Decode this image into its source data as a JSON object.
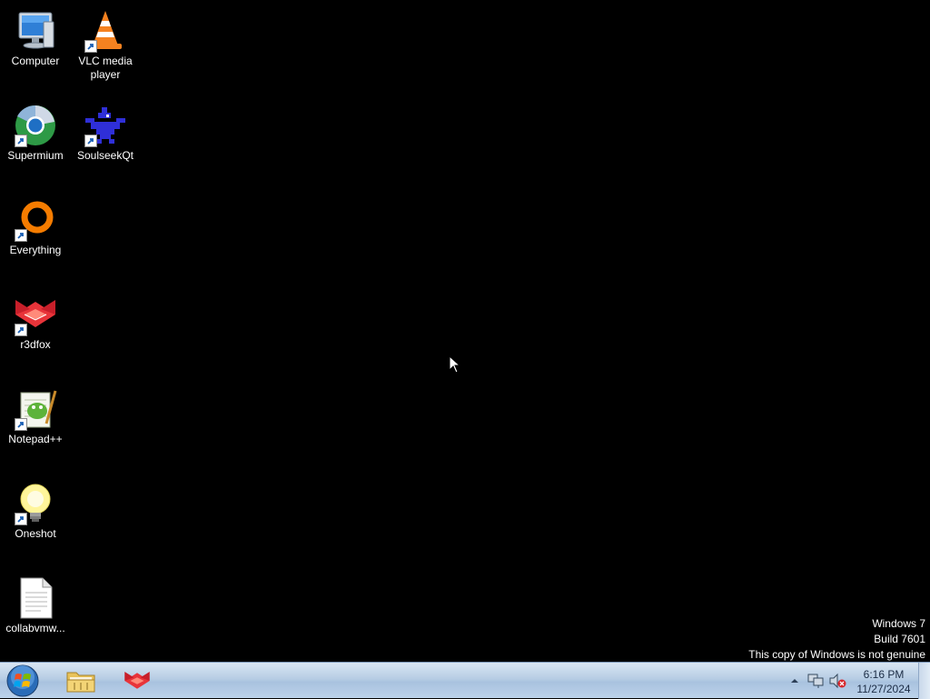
{
  "desktop": {
    "icons": [
      {
        "label": "Computer",
        "icon": "computer-icon"
      },
      {
        "label": "VLC media player",
        "icon": "vlc-icon"
      },
      {
        "label": "Supermium",
        "icon": "supermium-icon"
      },
      {
        "label": "SoulseekQt",
        "icon": "soulseek-icon"
      },
      {
        "label": "Everything",
        "icon": "everything-icon"
      },
      {
        "label": "r3dfox",
        "icon": "r3dfox-icon"
      },
      {
        "label": "Notepad++",
        "icon": "notepadpp-icon"
      },
      {
        "label": "Oneshot",
        "icon": "oneshot-icon"
      },
      {
        "label": "collabvmw...",
        "icon": "text-file-icon"
      }
    ]
  },
  "watermark": {
    "line1": "Windows 7",
    "line2": "Build 7601",
    "line3": "This copy of Windows is not genuine"
  },
  "taskbar": {
    "start_icon": "windows-orb-icon",
    "pinned": [
      {
        "name": "Windows Explorer",
        "icon": "folder-icon"
      },
      {
        "name": "r3dfox",
        "icon": "r3dfox-icon"
      }
    ],
    "tray": {
      "icons": [
        "show-hidden-icons",
        "network-icon",
        "volume-muted-icon"
      ]
    },
    "clock": {
      "time": "6:16 PM",
      "date": "11/27/2024"
    }
  }
}
